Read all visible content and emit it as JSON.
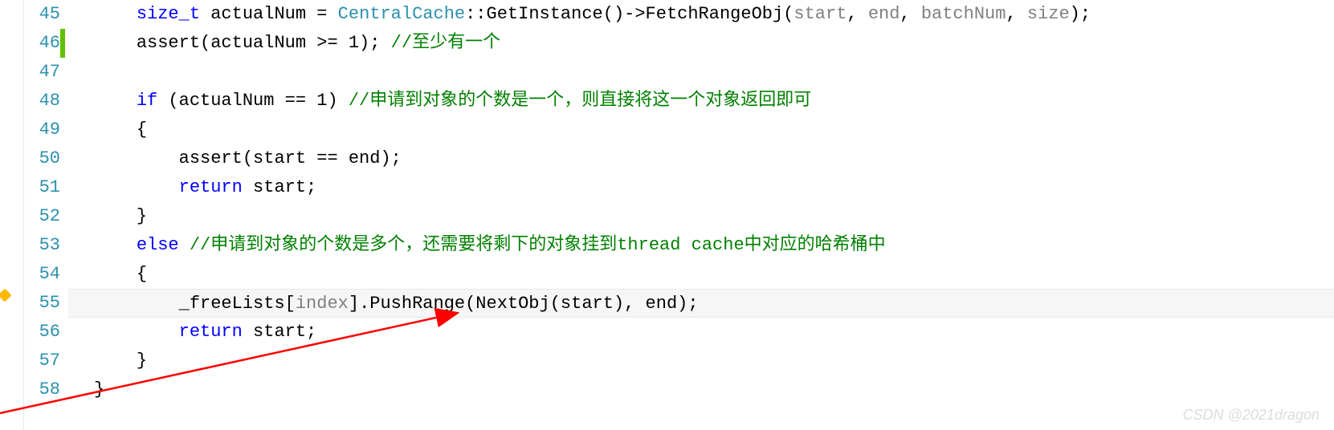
{
  "lines": [
    {
      "num": "45",
      "mod": false
    },
    {
      "num": "46",
      "mod": true
    },
    {
      "num": "47",
      "mod": false
    },
    {
      "num": "48",
      "mod": false
    },
    {
      "num": "49",
      "mod": false
    },
    {
      "num": "50",
      "mod": false
    },
    {
      "num": "51",
      "mod": false
    },
    {
      "num": "52",
      "mod": false
    },
    {
      "num": "53",
      "mod": false
    },
    {
      "num": "54",
      "mod": false
    },
    {
      "num": "55",
      "mod": false
    },
    {
      "num": "56",
      "mod": false
    },
    {
      "num": "57",
      "mod": false
    },
    {
      "num": "58",
      "mod": false
    }
  ],
  "code": {
    "l45": {
      "indent": "    ",
      "t1": "size_t",
      "t2": " actualNum = ",
      "t3": "CentralCache",
      "t4": "::GetInstance()->FetchRangeObj(",
      "p1": "start",
      "c1": ", ",
      "p2": "end",
      "c2": ", ",
      "p3": "batchNum",
      "c3": ", ",
      "p4": "size",
      "t5": ");"
    },
    "l46": {
      "indent": "    ",
      "t1": "assert(actualNum >= 1); ",
      "cm": "//至少有一个"
    },
    "l47": {
      "indent": ""
    },
    "l48": {
      "indent": "    ",
      "kw": "if",
      "t1": " (actualNum == 1) ",
      "cm": "//申请到对象的个数是一个，则直接将这一个对象返回即可"
    },
    "l49": {
      "indent": "    ",
      "t1": "{"
    },
    "l50": {
      "indent": "        ",
      "t1": "assert(start == end);"
    },
    "l51": {
      "indent": "        ",
      "kw": "return",
      "t1": " start;"
    },
    "l52": {
      "indent": "    ",
      "t1": "}"
    },
    "l53": {
      "indent": "    ",
      "kw": "else",
      "t1": " ",
      "cm": "//申请到对象的个数是多个，还需要将剩下的对象挂到thread cache中对应的哈希桶中"
    },
    "l54": {
      "indent": "    ",
      "t1": "{"
    },
    "l55": {
      "indent": "        ",
      "t1": "_freeLists[",
      "p1": "index",
      "t2": "].PushRange(NextObj(start), end);"
    },
    "l56": {
      "indent": "        ",
      "kw": "return",
      "t1": " start;"
    },
    "l57": {
      "indent": "    ",
      "t1": "}"
    },
    "l58": {
      "indent": "",
      "t1": "}"
    }
  },
  "watermark": "CSDN @2021dragon"
}
